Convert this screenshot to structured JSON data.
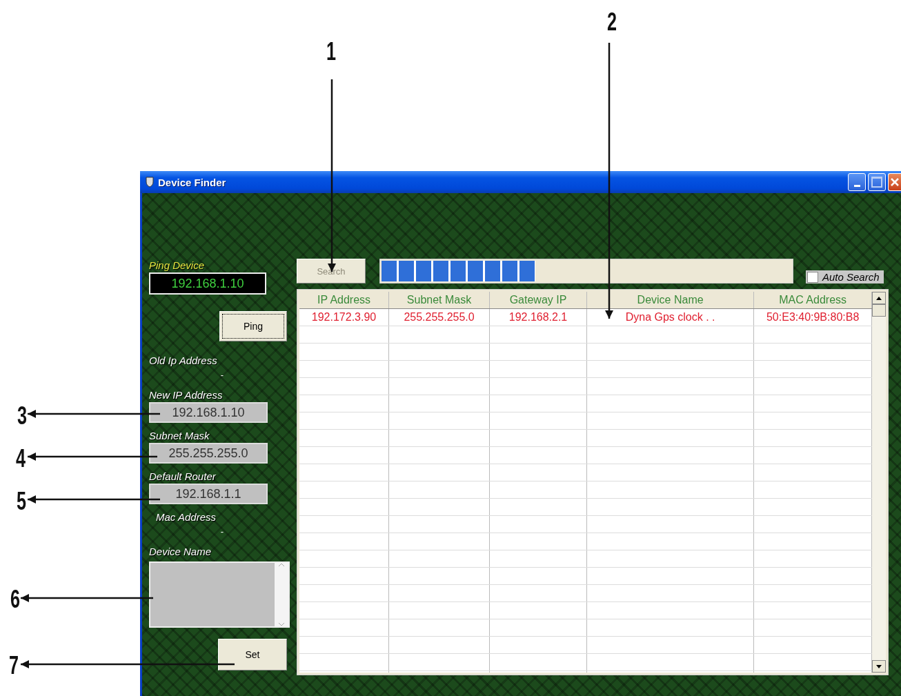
{
  "annotations": [
    {
      "label": "1"
    },
    {
      "label": "2"
    },
    {
      "label": "3"
    },
    {
      "label": "4"
    },
    {
      "label": "5"
    },
    {
      "label": "6"
    },
    {
      "label": "7"
    }
  ],
  "window": {
    "title": "Device Finder"
  },
  "ping_device": {
    "label": "Ping Device",
    "value": "192.168.1.10",
    "button": "Ping"
  },
  "old_ip_address": {
    "label": "Old Ip Address",
    "value": "-"
  },
  "fields": [
    {
      "label": "New IP Address",
      "value": "192.168.1.10"
    },
    {
      "label": "Subnet Mask",
      "value": "255.255.255.0"
    },
    {
      "label": "Default Router",
      "value": "192.168.1.1"
    }
  ],
  "mac_address": {
    "label": "Mac Address",
    "value": "-"
  },
  "device_name": {
    "label": "Device Name"
  },
  "set_button": "Set",
  "search_button": {
    "label": "Search",
    "disabled": true
  },
  "progress": {
    "level": 0.375
  },
  "auto_search": {
    "label": "Auto Search",
    "checked": false
  },
  "table": {
    "columns": [
      "IP Address",
      "Subnet Mask",
      "Gateway IP",
      "Device Name",
      "MAC Address"
    ],
    "rows": [
      [
        "192.172.3.90",
        "255.255.255.0",
        "192.168.2.1",
        "Dyna Gps clock  . .",
        "50:E3:40:9B:80:B8"
      ]
    ]
  }
}
